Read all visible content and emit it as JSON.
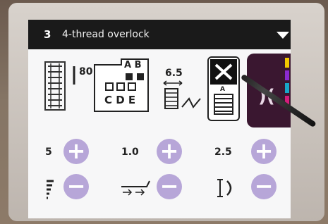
{
  "header": {
    "stitch_number": "3",
    "title": "4-thread overlock"
  },
  "info": {
    "needle_value": "80",
    "presser_top_letters": "A B",
    "presser_bottom_letters": "C D E",
    "stitch_width": "6.5",
    "stitch_letter": "A"
  },
  "controls": [
    {
      "value": "5"
    },
    {
      "value": "1.0"
    },
    {
      "value": "2.5"
    }
  ],
  "icons": [
    "stitch-pattern-icon",
    "needle-icon",
    "presser-foot-icon",
    "stitch-width-icon",
    "stitch-select-icon",
    "tension-icon",
    "feed-dog-icon",
    "thread-cutter-icon",
    "pointer-stylus"
  ],
  "colors": {
    "button": "#b7a6d8",
    "side_panel": "#3a1730",
    "side_tabs": [
      "#f2c800",
      "#8a2ad0",
      "#18a6c8",
      "#d31c7a"
    ]
  }
}
